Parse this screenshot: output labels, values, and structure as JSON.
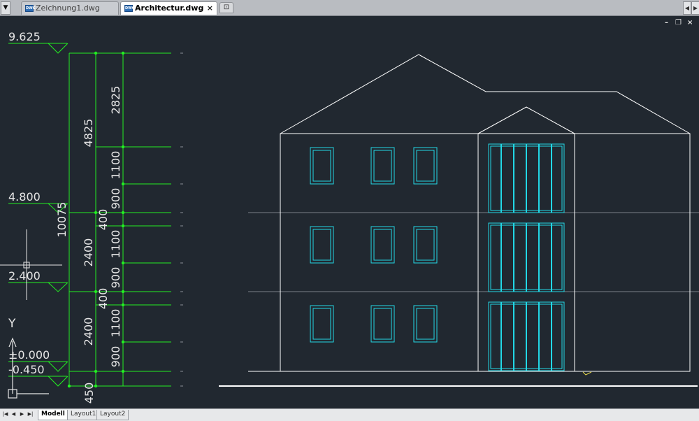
{
  "tabs": [
    {
      "name": "Zeichnung1.dwg",
      "icon": "dwg-file-icon",
      "active": false
    },
    {
      "name": "Architectur.dwg",
      "icon": "dwg-file-icon",
      "active": true
    }
  ],
  "tab_close_symbol": "×",
  "viewport_controls": {
    "minimize": "–",
    "restore": "❐",
    "close": "×"
  },
  "drawing": {
    "levels": [
      "9.625",
      "4.800",
      "2.400",
      "±0.000",
      "-0.450"
    ],
    "dimensions": {
      "total": "10075",
      "outer_bottom": "450",
      "upper_floor": "4825",
      "floor_height": "2400",
      "roof": "2825",
      "sill": "900",
      "window": "1100",
      "slab": "400"
    },
    "ucs_y_label": "Y",
    "colors": {
      "background": "#212830",
      "dimension_lines": "#22ee22",
      "building_outline": "#ffffff",
      "windows": "#22d8e6",
      "floor_lines": "#7a8088"
    }
  },
  "layout_tabs": [
    "Modell",
    "Layout1",
    "Layout2"
  ],
  "active_layout": "Modell"
}
